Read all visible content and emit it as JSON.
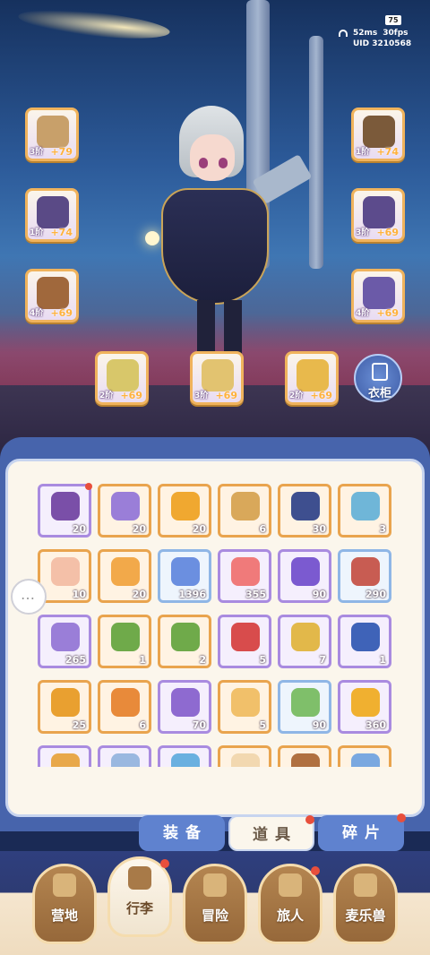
{
  "hud": {
    "battery": "75",
    "latency": "52ms",
    "fps": "30fps",
    "uid": "UID 3210568"
  },
  "equipment": [
    {
      "name": "weapon",
      "tier": "3阶",
      "plus": "+79",
      "color": "#c8a06a"
    },
    {
      "name": "helmet",
      "tier": "1阶",
      "plus": "+74",
      "color": "#7b5a3a"
    },
    {
      "name": "armor",
      "tier": "1阶",
      "plus": "+74",
      "color": "#5a4a86"
    },
    {
      "name": "gloves",
      "tier": "3阶",
      "plus": "+69",
      "color": "#5c4b8c"
    },
    {
      "name": "pants",
      "tier": "4阶",
      "plus": "+69",
      "color": "#a0683c"
    },
    {
      "name": "boots",
      "tier": "4阶",
      "plus": "+69",
      "color": "#6b5aa8"
    },
    {
      "name": "ring",
      "tier": "2阶",
      "plus": "+69",
      "color": "#d8c76a"
    },
    {
      "name": "necklace",
      "tier": "3阶",
      "plus": "+69",
      "color": "#e2c370"
    },
    {
      "name": "earring",
      "tier": "2阶",
      "plus": "+69",
      "color": "#e8b94c"
    }
  ],
  "wardrobe_label": "衣柜",
  "inventory": [
    {
      "count": "20",
      "color": "#7a4fa8",
      "frame": "purple",
      "badge": true
    },
    {
      "count": "20",
      "color": "#9a7ed8",
      "frame": "orange"
    },
    {
      "count": "20",
      "color": "#f0a830",
      "frame": "orange"
    },
    {
      "count": "6",
      "color": "#d9a85a",
      "frame": "orange"
    },
    {
      "count": "30",
      "color": "#3e4f8f",
      "frame": "orange"
    },
    {
      "count": "3",
      "color": "#6fb6d8",
      "frame": "orange"
    },
    {
      "count": "10",
      "color": "#f4c0a8",
      "frame": "orange"
    },
    {
      "count": "20",
      "color": "#f2a94a",
      "frame": "orange"
    },
    {
      "count": "1396",
      "color": "#6b8fe0",
      "frame": "blue"
    },
    {
      "count": "355",
      "color": "#f07a7a",
      "frame": "purple"
    },
    {
      "count": "90",
      "color": "#7b5ad0",
      "frame": "purple"
    },
    {
      "count": "290",
      "color": "#c85c52",
      "frame": "blue"
    },
    {
      "count": "265",
      "color": "#9a7ed8",
      "frame": "purple"
    },
    {
      "count": "1",
      "color": "#6faa4a",
      "frame": "orange"
    },
    {
      "count": "2",
      "color": "#6faa4a",
      "frame": "orange"
    },
    {
      "count": "5",
      "color": "#d84c4c",
      "frame": "purple"
    },
    {
      "count": "7",
      "color": "#e2b84a",
      "frame": "purple"
    },
    {
      "count": "1",
      "color": "#3f63b8",
      "frame": "purple"
    },
    {
      "count": "25",
      "color": "#e9a030",
      "frame": "orange"
    },
    {
      "count": "6",
      "color": "#e88a3a",
      "frame": "orange"
    },
    {
      "count": "70",
      "color": "#8e6ad0",
      "frame": "purple"
    },
    {
      "count": "5",
      "color": "#f1c06a",
      "frame": "orange"
    },
    {
      "count": "90",
      "color": "#7fbf6a",
      "frame": "blue"
    },
    {
      "count": "360",
      "color": "#f0b030",
      "frame": "purple"
    },
    {
      "count": "",
      "color": "#e8a84a",
      "frame": "purple"
    },
    {
      "count": "",
      "color": "#9ab8e0",
      "frame": "purple"
    },
    {
      "count": "",
      "color": "#6ab0e0",
      "frame": "purple"
    },
    {
      "count": "",
      "color": "#f2d8b0",
      "frame": "orange"
    },
    {
      "count": "",
      "color": "#b07040",
      "frame": "orange"
    },
    {
      "count": "",
      "color": "#7aa8e0",
      "frame": "orange"
    }
  ],
  "tabs": [
    {
      "label": "装备",
      "active": false,
      "badge": false
    },
    {
      "label": "道具",
      "active": true,
      "badge": true
    },
    {
      "label": "碎片",
      "active": false,
      "badge": true
    }
  ],
  "nav": [
    {
      "label": "营地",
      "active": false,
      "badge": false
    },
    {
      "label": "行李",
      "active": true,
      "badge": true
    },
    {
      "label": "冒险",
      "active": false,
      "badge": false
    },
    {
      "label": "旅人",
      "active": false,
      "badge": true
    },
    {
      "label": "麦乐兽",
      "active": false,
      "badge": false
    }
  ]
}
